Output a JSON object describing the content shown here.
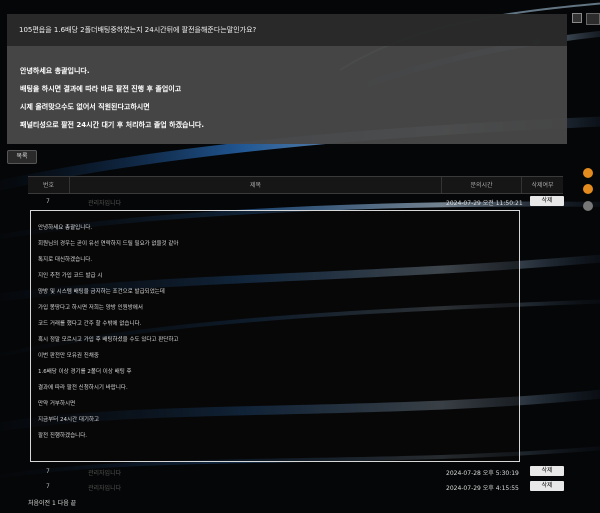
{
  "question": {
    "title": "105편읍을 1.6배당 2폴더배팅중하였는지 24시간뒤에 팔전을해준다는말인가요?",
    "answer_lines": [
      "안녕하세요 총괄입니다.",
      "배팅을 하시면 결과에 따라 바로 팔전 진행 후 졸업이고",
      "시제 올려맞으수도 없어서 직원된다고하시면",
      "패널티성으로 팔전 24시간 대기 후 처리하고 졸업 하겠습니다."
    ]
  },
  "list_button": "목록",
  "table": {
    "headers": [
      "번호",
      "제목",
      "문의시간",
      "삭제여부"
    ],
    "rows": [
      {
        "num": "7",
        "author": "관리자입니다",
        "date": "2024-07-29 오전 11:50:21",
        "del": "삭제"
      },
      {
        "num": "7",
        "author": "관리자입니다",
        "date": "2024-07-28 오후 5:30:19",
        "del": "삭제"
      },
      {
        "num": "7",
        "author": "관리자입니다",
        "date": "2024-07-29 오후 4:15:55",
        "del": "삭제"
      }
    ]
  },
  "detail_lines": [
    "안녕하세요 총괄입니다.",
    "회원님의 경우는 곧이 유선 연락하지 드릴 필요가 없을것 같아",
    "톡지로 대신하겠습니다.",
    "지인 추천 가입 코드 발급 시",
    "양방 및 시스템 배팅을 금지하는 조건으로 발급되었는데",
    "가입 몽땅다고 하시면 저희는 양방 인원방에서",
    "코드 거래를 했다고 간주 할 수밖에 없습니다.",
    "혹시 정말 모르시고 가입 후 배팅하셨을 수도 있다고 판단하고",
    "이번 판전만 모유권 진채중",
    "1.6배당 이상 경기를 2폴더 이상 배팅 후",
    "결과에 따라 팔전 신청하시기 바랍니다.",
    "만약 거부하시면",
    "지금부터 24시간 대기하고",
    "팔전 진행하겠습니다."
  ],
  "pager": "처음이전 1 다음 끝"
}
